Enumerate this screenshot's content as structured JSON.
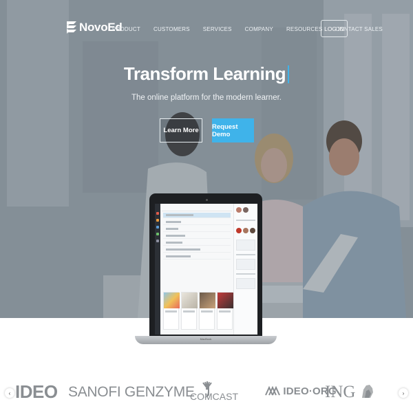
{
  "brand": {
    "name": "NovoEd",
    "logo_icon": "novoed-logo-icon",
    "accent_color": "#3fb3ea"
  },
  "nav": {
    "links": [
      "PRODUCT",
      "CUSTOMERS",
      "SERVICES",
      "COMPANY",
      "RESOURCES",
      "CONTACT SALES"
    ],
    "login_label": "LOG IN"
  },
  "hero": {
    "headline": "Transform Learning",
    "subheadline": "The online platform for the modern learner.",
    "learn_more_label": "Learn More",
    "request_demo_label": "Request Demo"
  },
  "laptop": {
    "brand_label": "MacBook"
  },
  "clients": {
    "logos": [
      "IDEO",
      "SANOFI GENZYME",
      "COMCAST",
      "IDEO·ORG",
      "ING"
    ],
    "prev_icon": "chevron-left-icon",
    "next_icon": "chevron-right-icon"
  }
}
